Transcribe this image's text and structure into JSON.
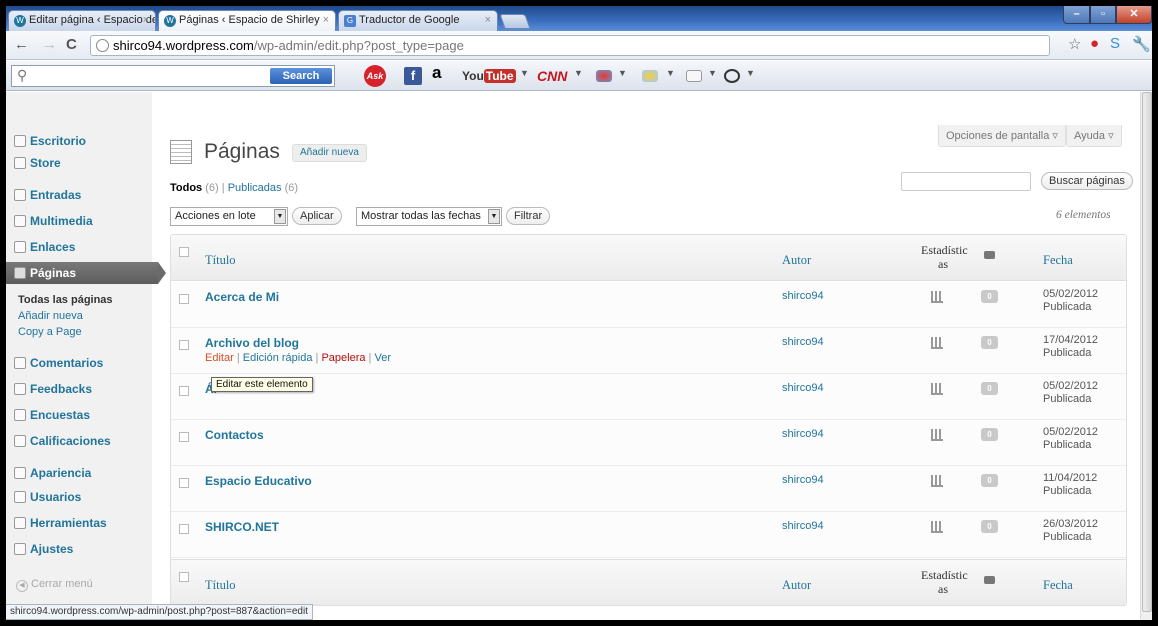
{
  "browser": {
    "tabs": [
      {
        "label": "Editar página ‹ Espacio de S",
        "favicon": "wordpress-icon"
      },
      {
        "label": "Páginas ‹ Espacio de Shirley",
        "favicon": "wordpress-icon"
      },
      {
        "label": "Traductor de Google",
        "favicon": "google-translate-icon"
      }
    ],
    "url_host": "shirco94.wordpress.com",
    "url_path": "/wp-admin/edit.php?post_type=page",
    "status_url": "shirco94.wordpress.com/wp-admin/post.php?post=887&action=edit"
  },
  "toolbar": {
    "search_label": "Search",
    "ask_label": "Ask",
    "amazon_label": "a",
    "youtube_you": "You",
    "youtube_tube": "Tube",
    "cnn_label": "CNN"
  },
  "sidebar": {
    "items": [
      {
        "label": "Escritorio",
        "icon": "home-icon"
      },
      {
        "label": "Store",
        "icon": "cart-icon"
      },
      {
        "label": "Entradas",
        "icon": "pin-icon"
      },
      {
        "label": "Multimedia",
        "icon": "media-icon"
      },
      {
        "label": "Enlaces",
        "icon": "link-icon"
      },
      {
        "label": "Páginas",
        "icon": "page-icon"
      },
      {
        "label": "Comentarios",
        "icon": "comment-icon"
      },
      {
        "label": "Feedbacks",
        "icon": "feedback-icon"
      },
      {
        "label": "Encuestas",
        "icon": "poll-icon"
      },
      {
        "label": "Calificaciones",
        "icon": "rating-icon"
      },
      {
        "label": "Apariencia",
        "icon": "appearance-icon"
      },
      {
        "label": "Usuarios",
        "icon": "users-icon"
      },
      {
        "label": "Herramientas",
        "icon": "tools-icon"
      },
      {
        "label": "Ajustes",
        "icon": "settings-icon"
      }
    ],
    "submenu": [
      "Todas las páginas",
      "Añadir nueva",
      "Copy a Page"
    ],
    "collapse_label": "Cerrar menú"
  },
  "header": {
    "screen_options": "Opciones de pantalla",
    "help": "Ayuda",
    "title": "Páginas",
    "add_new": "Añadir nueva"
  },
  "filters": {
    "all_label": "Todos",
    "all_count": "(6)",
    "separator": "|",
    "published_label": "Publicadas",
    "published_count": "(6)",
    "search_button": "Buscar páginas",
    "bulk_actions": "Acciones en lote",
    "apply": "Aplicar",
    "dates": "Mostrar todas las fechas",
    "filter": "Filtrar",
    "items_count": "6 elementos"
  },
  "table": {
    "headers": {
      "title": "Título",
      "author": "Autor",
      "stats_line1": "Estadístic",
      "stats_line2": "as",
      "date": "Fecha"
    },
    "rows": [
      {
        "title": "Acerca de Mi",
        "author": "shirco94",
        "date": "05/02/2012",
        "status": "Publicada",
        "comments": "0"
      },
      {
        "title": "Archivo del blog",
        "author": "shirco94",
        "date": "17/04/2012",
        "status": "Publicada",
        "comments": "0"
      },
      {
        "title": "Ál",
        "author": "shirco94",
        "date": "05/02/2012",
        "status": "Publicada",
        "comments": "0"
      },
      {
        "title": "Contactos",
        "author": "shirco94",
        "date": "05/02/2012",
        "status": "Publicada",
        "comments": "0"
      },
      {
        "title": "Espacio Educativo",
        "author": "shirco94",
        "date": "11/04/2012",
        "status": "Publicada",
        "comments": "0"
      },
      {
        "title": "SHIRCO.NET",
        "author": "shirco94",
        "date": "26/03/2012",
        "status": "Publicada",
        "comments": "0"
      }
    ],
    "row_actions": {
      "edit": "Editar",
      "quick_edit": "Edición rápida",
      "trash": "Papelera",
      "view": "Ver",
      "sep": "|"
    },
    "tooltip": "Editar este elemento"
  }
}
